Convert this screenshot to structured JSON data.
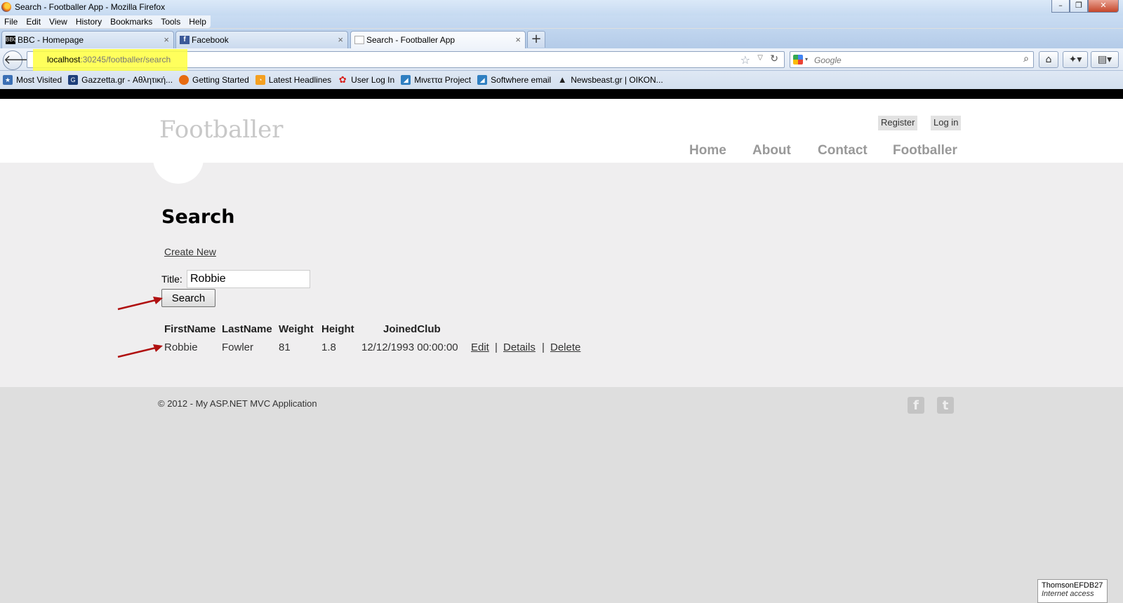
{
  "window": {
    "title": "Search - Footballer App - Mozilla Firefox"
  },
  "menu": [
    "File",
    "Edit",
    "View",
    "History",
    "Bookmarks",
    "Tools",
    "Help"
  ],
  "tabs": [
    {
      "label": "BBC - Homepage",
      "icon": "bbc-icon"
    },
    {
      "label": "Facebook",
      "icon": "facebook-icon"
    },
    {
      "label": "Search - Footballer App",
      "icon": "page-icon",
      "active": true
    }
  ],
  "address": {
    "host": "localhost",
    "path": ":30245/footballer/search"
  },
  "search_engine": {
    "placeholder": "Google"
  },
  "bookmarks": [
    {
      "label": "Most Visited",
      "icon": "most-visited-icon",
      "color": "#3a6fb5"
    },
    {
      "label": "Gazzetta.gr - Αθλητική...",
      "icon": "gazzetta-icon",
      "color": "#1e3f7a"
    },
    {
      "label": "Getting Started",
      "icon": "firefox-icon",
      "color": "#e76b11"
    },
    {
      "label": "Latest Headlines",
      "icon": "rss-icon",
      "color": "#f4a020"
    },
    {
      "label": "User Log In",
      "icon": "flower-icon",
      "color": "#d8201c"
    },
    {
      "label": "Μινεττα Project",
      "icon": "minetta-icon",
      "color": "#2f7fc1"
    },
    {
      "label": "Softwhere email",
      "icon": "softwhere-icon",
      "color": "#2f7fc1"
    },
    {
      "label": "Newsbeast.gr | ΟΙΚΟΝ...",
      "icon": "newsbeast-icon",
      "color": "#222222"
    }
  ],
  "site": {
    "title": "Footballer",
    "register": "Register",
    "login": "Log in",
    "nav": [
      "Home",
      "About",
      "Contact",
      "Footballer"
    ]
  },
  "content": {
    "heading": "Search",
    "create_new": "Create New",
    "title_label": "Title:",
    "title_value": "Robbie",
    "search_button": "Search",
    "columns": [
      "FirstName",
      "LastName",
      "Weight",
      "Height",
      "JoinedClub"
    ],
    "rows": [
      {
        "firstname": "Robbie",
        "lastname": "Fowler",
        "weight": "81",
        "height": "1.8",
        "joined": "12/12/1993 00:00:00",
        "actions": [
          "Edit",
          "Details",
          "Delete"
        ]
      }
    ],
    "separator": "|"
  },
  "footer": {
    "copyright": "© 2012 - My ASP.NET MVC Application",
    "facebook_glyph": "f",
    "twitter_glyph": "t"
  },
  "network_tip": {
    "name": "ThomsonEFDB27",
    "status": "Internet access"
  },
  "colors": {
    "arrow": "#b01010",
    "url_highlight": "#ffff40"
  }
}
